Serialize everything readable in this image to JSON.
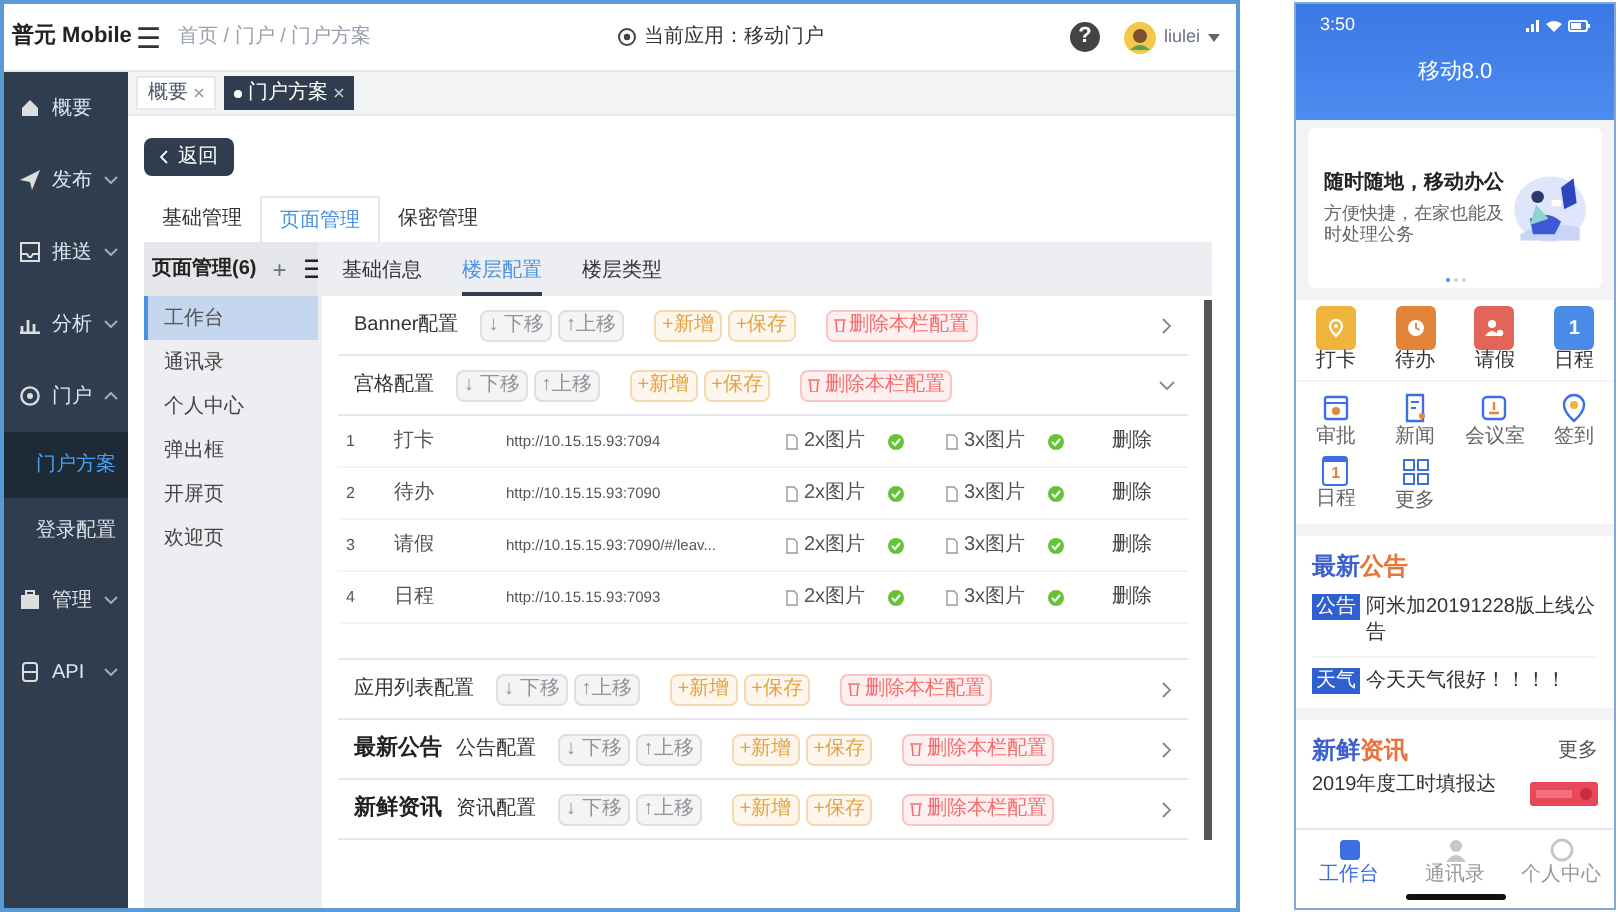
{
  "header": {
    "logo": "普元 Mobile",
    "menu": "☰",
    "breadcrumb": "首页 / 门户 / 门户方案",
    "current_app": "当前应用：移动门户",
    "help": "?",
    "user": "liulei"
  },
  "sidebar": [
    {
      "label": "概要",
      "selected": false
    },
    {
      "label": "发布",
      "selected": false,
      "expanded": false
    },
    {
      "label": "推送",
      "selected": false,
      "expanded": false
    },
    {
      "label": "分析",
      "selected": false,
      "expanded": false
    },
    {
      "label": "门户",
      "selected": false,
      "expanded": true,
      "children": [
        {
          "label": "门户方案",
          "selected": true
        },
        {
          "label": "登录配置",
          "selected": false
        }
      ]
    },
    {
      "label": "管理",
      "selected": false,
      "expanded": false
    },
    {
      "label": "API",
      "selected": false,
      "expanded": false
    }
  ],
  "open_tabs": [
    {
      "label": "概要",
      "selected": false
    },
    {
      "label": "门户方案",
      "selected": true
    }
  ],
  "back_button": "返回",
  "main_tabs": [
    {
      "label": "基础管理",
      "selected": false
    },
    {
      "label": "页面管理",
      "selected": true
    },
    {
      "label": "保密管理",
      "selected": false
    }
  ],
  "page_list": {
    "title": "页面管理(6)",
    "add": "+",
    "menu": "☰",
    "items": [
      {
        "label": "工作台",
        "selected": true
      },
      {
        "label": "通讯录",
        "selected": false
      },
      {
        "label": "个人中心",
        "selected": false
      },
      {
        "label": "弹出框",
        "selected": false
      },
      {
        "label": "开屏页",
        "selected": false
      },
      {
        "label": "欢迎页",
        "selected": false
      }
    ]
  },
  "floor_tabs": [
    {
      "label": "基础信息",
      "selected": false
    },
    {
      "label": "楼层配置",
      "selected": true
    },
    {
      "label": "楼层类型",
      "selected": false
    }
  ],
  "sections": [
    {
      "title": "Banner配置",
      "expanded": false,
      "buttons": [
        {
          "kind": "grey",
          "label": "↓ 下移"
        },
        {
          "kind": "grey",
          "label": "↑上移"
        },
        {
          "kind": "orange",
          "label": "+新增"
        },
        {
          "kind": "orange",
          "label": "+保存"
        },
        {
          "kind": "red",
          "label": "删除本栏配置"
        }
      ]
    },
    {
      "title": "宫格配置",
      "expanded": true,
      "buttons": [
        {
          "kind": "grey",
          "label": "↓ 下移"
        },
        {
          "kind": "grey",
          "label": "↑上移"
        },
        {
          "kind": "orange",
          "label": "+新增"
        },
        {
          "kind": "orange",
          "label": "+保存"
        },
        {
          "kind": "red",
          "label": "删除本栏配置"
        }
      ],
      "rows": [
        {
          "no": "1",
          "name": "打卡",
          "url": "http://10.15.15.93:7094",
          "img2x": "2x图片",
          "img3x": "3x图片",
          "action": "删除"
        },
        {
          "no": "2",
          "name": "待办",
          "url": "http://10.15.15.93:7090",
          "img2x": "2x图片",
          "img3x": "3x图片",
          "action": "删除"
        },
        {
          "no": "3",
          "name": "请假",
          "url": "http://10.15.15.93:7090/#/leav...",
          "img2x": "2x图片",
          "img3x": "3x图片",
          "action": "删除"
        },
        {
          "no": "4",
          "name": "日程",
          "url": "http://10.15.15.93:7093",
          "img2x": "2x图片",
          "img3x": "3x图片",
          "action": "删除"
        }
      ]
    },
    {
      "title": "应用列表配置",
      "expanded": false,
      "buttons": [
        {
          "kind": "grey",
          "label": "↓ 下移"
        },
        {
          "kind": "grey",
          "label": "↑上移"
        },
        {
          "kind": "orange",
          "label": "+新增"
        },
        {
          "kind": "orange",
          "label": "+保存"
        },
        {
          "kind": "red",
          "label": "删除本栏配置"
        }
      ]
    },
    {
      "heading": "最新公告",
      "title": "公告配置",
      "expanded": false,
      "buttons": [
        {
          "kind": "grey",
          "label": "↓ 下移"
        },
        {
          "kind": "grey",
          "label": "↑上移"
        },
        {
          "kind": "orange",
          "label": "+新增"
        },
        {
          "kind": "orange",
          "label": "+保存"
        },
        {
          "kind": "red",
          "label": "删除本栏配置"
        }
      ]
    },
    {
      "heading": "新鲜资讯",
      "title": "资讯配置",
      "expanded": false,
      "buttons": [
        {
          "kind": "grey",
          "label": "↓ 下移"
        },
        {
          "kind": "grey",
          "label": "↑上移"
        },
        {
          "kind": "orange",
          "label": "+新增"
        },
        {
          "kind": "orange",
          "label": "+保存"
        },
        {
          "kind": "red",
          "label": "删除本栏配置"
        }
      ]
    }
  ],
  "phone": {
    "time": "3:50",
    "title": "移动8.0",
    "banner": {
      "headline": "随时随地，移动办公",
      "subtitle": "方便快捷，在家也能及时处理公务",
      "dots": [
        {
          "selected": true
        },
        {
          "selected": false
        },
        {
          "selected": false
        }
      ]
    },
    "quick": [
      {
        "label": "打卡",
        "color": "#f0b43c"
      },
      {
        "label": "待办",
        "color": "#e3843a"
      },
      {
        "label": "请假",
        "color": "#e2655a"
      },
      {
        "label": "日程",
        "color": "#4a8be8",
        "glyph": "1"
      }
    ],
    "apps": [
      {
        "label": "审批"
      },
      {
        "label": "新闻"
      },
      {
        "label": "会议室"
      },
      {
        "label": "签到"
      },
      {
        "label": "日程",
        "glyph": "1"
      },
      {
        "label": "更多"
      }
    ],
    "notices": {
      "title_lead": "最新",
      "title_rest": "公告",
      "items": [
        {
          "tag": "公告",
          "text": "阿米加20191228版上线公告"
        },
        {
          "tag": "天气",
          "text": "今天天气很好！！！！"
        }
      ]
    },
    "news": {
      "title_lead": "新鲜",
      "title_rest": "资讯",
      "more": "更多",
      "items": [
        {
          "text": "2019年度工时填报达"
        }
      ]
    },
    "tabbar": [
      {
        "label": "工作台",
        "selected": true
      },
      {
        "label": "通讯录",
        "selected": false
      },
      {
        "label": "个人中心",
        "selected": false
      }
    ]
  }
}
